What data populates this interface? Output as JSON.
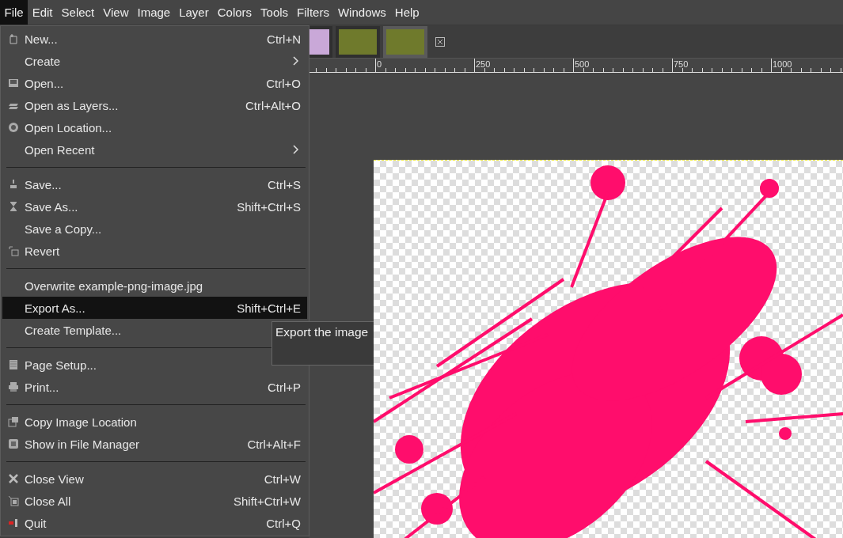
{
  "menubar": [
    {
      "label": "File",
      "selected": true
    },
    {
      "label": "Edit",
      "selected": false
    },
    {
      "label": "Select",
      "selected": false
    },
    {
      "label": "View",
      "selected": false
    },
    {
      "label": "Image",
      "selected": false
    },
    {
      "label": "Layer",
      "selected": false
    },
    {
      "label": "Colors",
      "selected": false
    },
    {
      "label": "Tools",
      "selected": false
    },
    {
      "label": "Filters",
      "selected": false
    },
    {
      "label": "Windows",
      "selected": false
    },
    {
      "label": "Help",
      "selected": false
    }
  ],
  "image_tabs": [
    {
      "selected": false
    },
    {
      "selected": false
    },
    {
      "selected": true
    }
  ],
  "ruler": {
    "labels": [
      "0",
      "250",
      "500",
      "750",
      "1000"
    ]
  },
  "file_menu": {
    "groups": [
      [
        {
          "label": "New...",
          "shortcut": "Ctrl+N",
          "submenu": false,
          "selected": false
        },
        {
          "label": "Create",
          "submenu": true,
          "selected": false
        },
        {
          "label": "Open...",
          "shortcut": "Ctrl+O",
          "submenu": false,
          "selected": false
        },
        {
          "label": "Open as Layers...",
          "shortcut": "Ctrl+Alt+O",
          "submenu": false,
          "selected": false
        },
        {
          "label": "Open Location...",
          "submenu": false,
          "selected": false
        },
        {
          "label": "Open Recent",
          "submenu": true,
          "selected": false
        }
      ],
      [
        {
          "label": "Save...",
          "shortcut": "Ctrl+S",
          "submenu": false,
          "selected": false
        },
        {
          "label": "Save As...",
          "shortcut": "Shift+Ctrl+S",
          "submenu": false,
          "selected": false
        },
        {
          "label": "Save a Copy...",
          "submenu": false,
          "selected": false
        },
        {
          "label": "Revert",
          "submenu": false,
          "selected": false
        }
      ],
      [
        {
          "label": "Overwrite example-png-image.jpg",
          "submenu": false,
          "selected": false
        },
        {
          "label": "Export As...",
          "shortcut": "Shift+Ctrl+E",
          "submenu": false,
          "selected": true
        },
        {
          "label": "Create Template...",
          "selected": false
        }
      ],
      [
        {
          "label": "Page Setup...",
          "submenu": false,
          "selected": false
        },
        {
          "label": "Print...",
          "shortcut": "Ctrl+P",
          "submenu": false,
          "selected": false
        }
      ],
      [
        {
          "label": "Copy Image Location",
          "submenu": false,
          "selected": false
        },
        {
          "label": "Show in File Manager",
          "shortcut": "Ctrl+Alt+F",
          "submenu": false,
          "selected": false
        }
      ],
      [
        {
          "label": "Close View",
          "shortcut": "Ctrl+W",
          "submenu": false,
          "selected": false
        },
        {
          "label": "Close All",
          "shortcut": "Shift+Ctrl+W",
          "submenu": false,
          "selected": false
        },
        {
          "label": "Quit",
          "shortcut": "Ctrl+Q",
          "submenu": false,
          "selected": false
        }
      ]
    ]
  },
  "tooltip": {
    "text": "Export the image"
  }
}
